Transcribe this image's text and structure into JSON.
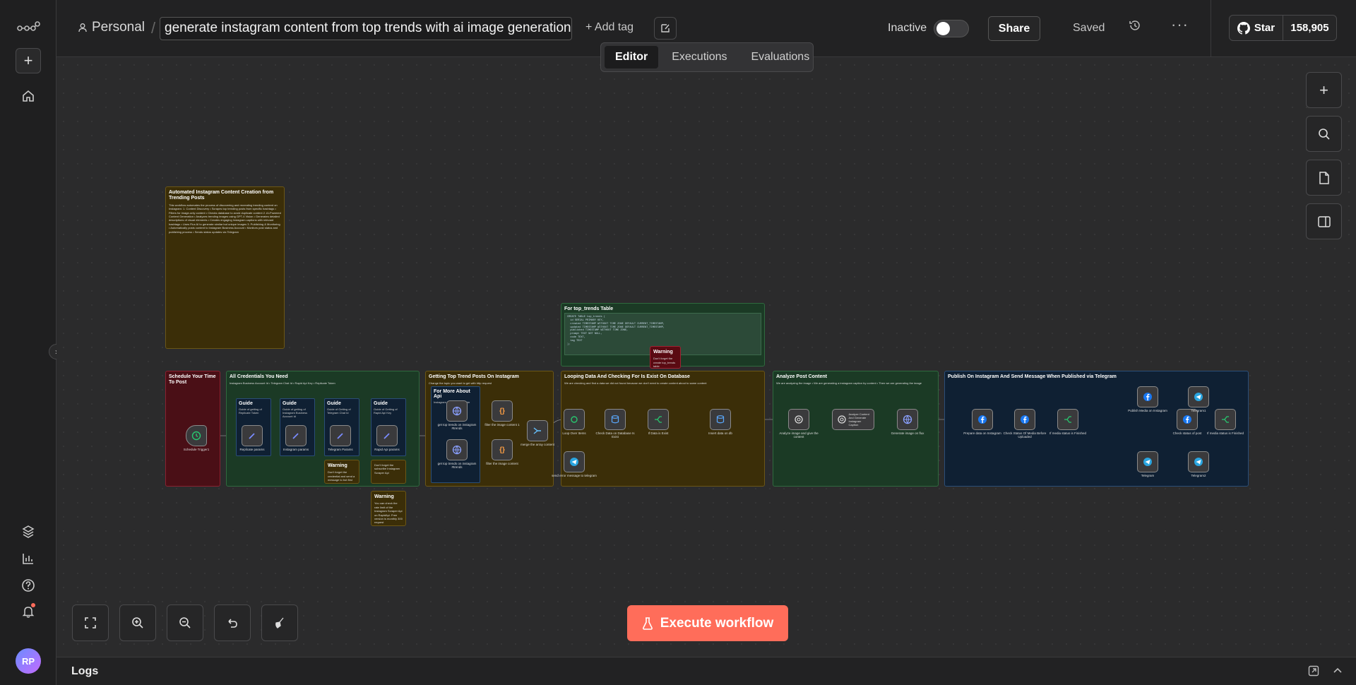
{
  "header": {
    "project": "Personal",
    "workflow_name": "generate instagram content from top trends with ai image generation",
    "add_tag": "+ Add tag",
    "status_label": "Inactive",
    "share": "Share",
    "saved": "Saved",
    "more": "···",
    "github_star": "Star",
    "github_count": "158,905"
  },
  "tabs": [
    "Editor",
    "Executions",
    "Evaluations"
  ],
  "rail": {
    "avatar": "RP"
  },
  "canvas": {
    "execute": "Execute workflow"
  },
  "logs": {
    "title": "Logs"
  },
  "stickies": {
    "overview_title": "Automated Instagram Content Creation from Trending Posts",
    "overview_body": "This workflow automates the process of discovering and recreating trending content on Instagram: 1. Content Discovery • Scrapes top trending posts from specific hashtags • Filters for image-only content • Checks database to avoid duplicate content 2. AI-Powered Content Generation • Analyzes trending images using GPT-4 Vision • Generates detailed descriptions of visual elements • Creates engaging Instagram captions with relevant hashtags • Uses Flux AI to generate similar but unique images 3. Publishing & Monitoring • Automatically posts content to Instagram Business Account • Monitors post status and publishing process • Sends status updates via Telegram",
    "table_title": "For top_trends Table",
    "table_code": "CREATE TABLE top_trends (\n  id SERIAL PRIMARY KEY,\n  created TIMESTAMP WITHOUT TIME ZONE DEFAULT CURRENT_TIMESTAMP,\n  updated TIMESTAMP WITHOUT TIME ZONE DEFAULT CURRENT_TIMESTAMP,\n  published TIMESTAMP WITHOUT TIME ZONE,\n  prompt TEXT NOT NULL,\n  code TEXT,\n  tag TEXT\n);",
    "warning_title": "Warning",
    "warning_body": "Don't forget the create top_trends table",
    "schedule_title": "Schedule Your Time To Post",
    "creds_title": "All Credentials You Need",
    "creds_body": "Instagram Business Account Id • Telegram Chat Id • Rapid Api Key • Replicate Token",
    "guide_title": "Guide",
    "guide1_body": "Guide of getting of Replicate Token",
    "guide2_body": "Guide of getting of Instagram Business Account Id",
    "guide3_body": "Guide of Getting of Telegram Chat Id",
    "guide4_body": "Guide of Getting of Rapid Api Key",
    "warn2_title": "Warning",
    "warn2_body": "Don't forget the credential and send a message to bot first",
    "warn3_body": "Don't forget the subscribe Instagram Scraper Api",
    "warn4_title": "Warning",
    "warn4_body": "You can check the rate limit of the Instagram Scraper Api on RapidApi. Free version is monthly 300 request",
    "trend_title": "Getting Top Trend Posts On Instagram",
    "trend_body": "Change the topic you want to get with http request",
    "api_title": "For More About Api",
    "api_body": "Instagram Scraper Api Guide",
    "loop_title": "Looping Data And Checking For Is Exist On Database",
    "loop_body": "We are checking and find a data we did not found because we don't need to create content about to same content",
    "analyze_title": "Analyze Post Content",
    "analyze_body": "We are analyzing the image • We are generating a instagram caption by content • Then we are generating the image",
    "publish_title": "Publish On Instagram And Send Message When Published via Telegram"
  },
  "nodes": {
    "schedule": "Schedule Trigger1",
    "rep_params": "Replicate params",
    "ig_params": "Instagram params",
    "tg_params": "Telegram Params",
    "rapid_params": "Rapid Api params",
    "get_trends_1": "get top trends on instagram #trends",
    "get_trends_2": "get top trends on instagram #trends",
    "filter_1": "filter the image content 1",
    "filter_2": "filter the image content",
    "merge": "merge the array content",
    "loop": "Loop Over Items",
    "check_db": "Check Data on Database Is Exist",
    "if_exist": "If Data is Exist",
    "insert": "Insert data on db",
    "send_error": "send error message to telegram",
    "analyze_img": "Analyze image and give the content",
    "caption": "Analyze Content And Generate Instagram Caption",
    "gen_image": "Generate image on flux",
    "prepare": "Prepare data on Instagram",
    "check_media": "Check Status Of Media Before Uploaded",
    "if_media_1": "If media status is Finished",
    "publish_media": "Publish Media on Instagram",
    "check_post": "Check status of post",
    "if_media_2": "If media status is Finished",
    "telegram_1": "Telegram",
    "telegram_2": "Telegram1",
    "telegram_3": "Telegram2"
  },
  "colors": {
    "accent": "#ff6d5a",
    "canvas_bg": "#2b2b2c",
    "sticky_yellow": "#3b2e08",
    "sticky_red": "#4a0f16",
    "sticky_green": "#1b3a25",
    "sticky_blue": "#0f2033"
  }
}
